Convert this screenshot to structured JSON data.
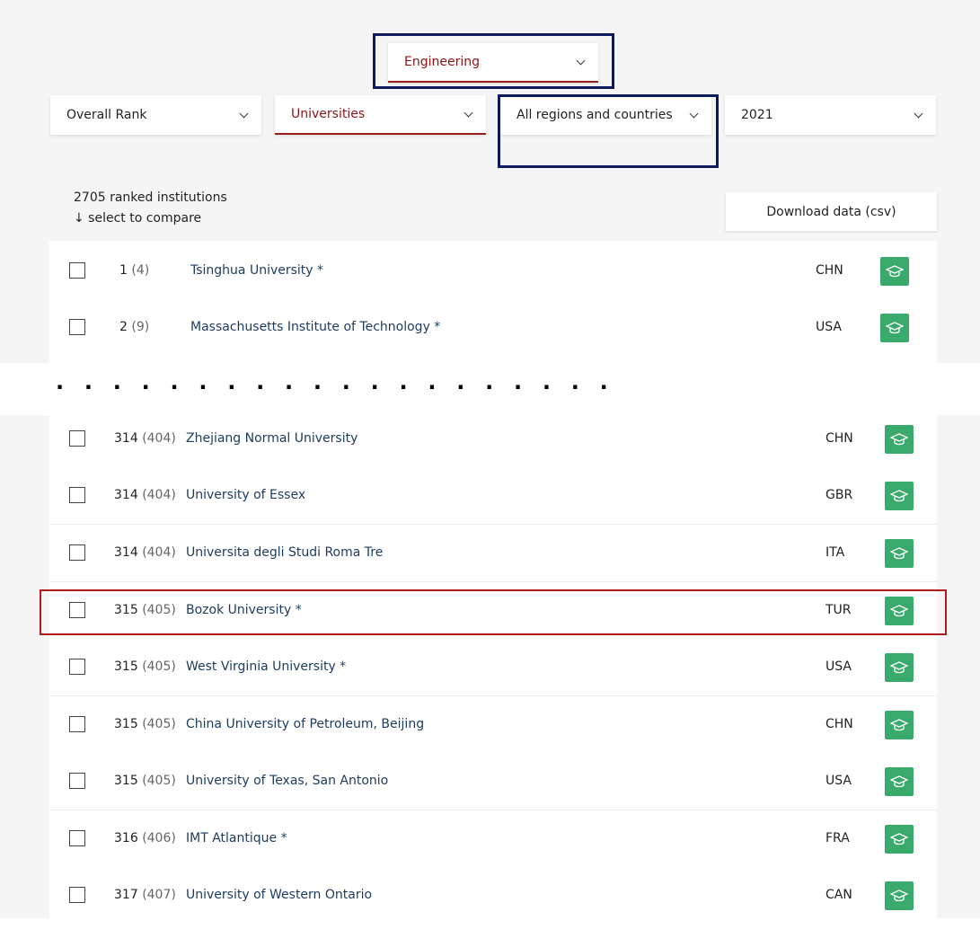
{
  "filters": {
    "subject": "Engineering",
    "rank_type": "Overall Rank",
    "institution_type": "Universities",
    "region": "All regions and countries",
    "year": "2021"
  },
  "summary": {
    "count_text": "2705 ranked institutions",
    "compare_hint": "↓ select to compare"
  },
  "download_label": "Download data (csv)",
  "gap_marker": ". . . . . . . . . . . . . . . . . . . .",
  "top_rows": [
    {
      "rank": "1",
      "prev": "(4)",
      "name": "Tsinghua University *",
      "country": "CHN"
    },
    {
      "rank": "2",
      "prev": "(9)",
      "name": "Massachusetts Institute of Technology *",
      "country": "USA"
    }
  ],
  "rows": [
    {
      "rank": "314",
      "prev": "(404)",
      "name": "Zhejiang Normal University",
      "country": "CHN"
    },
    {
      "rank": "314",
      "prev": "(404)",
      "name": "University of Essex",
      "country": "GBR"
    },
    {
      "rank": "314",
      "prev": "(404)",
      "name": "Universita degli Studi Roma Tre",
      "country": "ITA"
    },
    {
      "rank": "315",
      "prev": "(405)",
      "name": "Bozok University *",
      "country": "TUR"
    },
    {
      "rank": "315",
      "prev": "(405)",
      "name": "West Virginia University *",
      "country": "USA"
    },
    {
      "rank": "315",
      "prev": "(405)",
      "name": "China University of Petroleum, Beijing",
      "country": "CHN"
    },
    {
      "rank": "315",
      "prev": "(405)",
      "name": "University of Texas, San Antonio",
      "country": "USA"
    },
    {
      "rank": "316",
      "prev": "(406)",
      "name": "IMT Atlantique *",
      "country": "FRA"
    },
    {
      "rank": "317",
      "prev": "(407)",
      "name": "University of Western Ontario",
      "country": "CAN"
    }
  ],
  "colors": {
    "accent_red": "#9b1c1c",
    "highlight_navy": "#0d1b5e",
    "highlight_red": "#b01c1c",
    "icon_green": "#3aaa6c",
    "link_blue": "#1c3a5e"
  },
  "icons": {
    "dropdown": "chevron-down-icon",
    "profile": "graduation-cap-icon"
  }
}
